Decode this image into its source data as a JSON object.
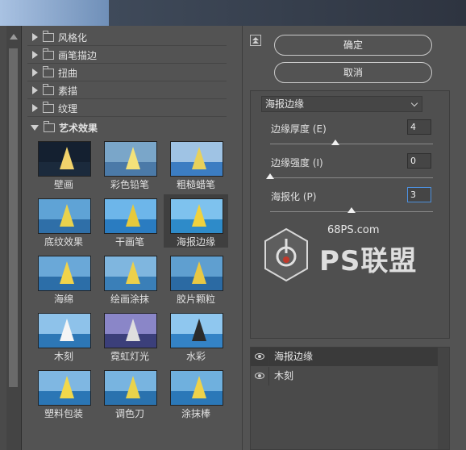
{
  "categories": [
    {
      "label": "风格化",
      "open": false
    },
    {
      "label": "画笔描边",
      "open": false
    },
    {
      "label": "扭曲",
      "open": false
    },
    {
      "label": "素描",
      "open": false
    },
    {
      "label": "纹理",
      "open": false
    },
    {
      "label": "艺术效果",
      "open": true
    }
  ],
  "thumbnails": [
    {
      "label": "壁画",
      "selected": false
    },
    {
      "label": "彩色铅笔",
      "selected": false
    },
    {
      "label": "粗糙蜡笔",
      "selected": false
    },
    {
      "label": "底纹效果",
      "selected": false
    },
    {
      "label": "干画笔",
      "selected": false
    },
    {
      "label": "海报边缘",
      "selected": true
    },
    {
      "label": "海绵",
      "selected": false
    },
    {
      "label": "绘画涂抹",
      "selected": false
    },
    {
      "label": "胶片颗粒",
      "selected": false
    },
    {
      "label": "木刻",
      "selected": false
    },
    {
      "label": "霓虹灯光",
      "selected": false
    },
    {
      "label": "水彩",
      "selected": false
    },
    {
      "label": "塑料包装",
      "selected": false
    },
    {
      "label": "调色刀",
      "selected": false
    },
    {
      "label": "涂抹棒",
      "selected": false
    }
  ],
  "buttons": {
    "ok": "确定",
    "cancel": "取消"
  },
  "filter_select": "海报边缘",
  "params": [
    {
      "label": "边缘厚度 (E)",
      "value": "4",
      "level": 0.4,
      "focused": false
    },
    {
      "label": "边缘强度 (I)",
      "value": "0",
      "level": 0.0,
      "focused": false
    },
    {
      "label": "海报化 (P)",
      "value": "3",
      "level": 0.5,
      "focused": true
    }
  ],
  "watermark": {
    "url": "68PS.com",
    "brand": "PS联盟"
  },
  "layers": [
    {
      "name": "海报边缘",
      "active": true
    },
    {
      "name": "木刻",
      "active": false
    }
  ],
  "colors": {
    "panel_bg": "#535353",
    "focus_border": "#4d8fdc",
    "selected_cell": "#3f3f3f"
  }
}
